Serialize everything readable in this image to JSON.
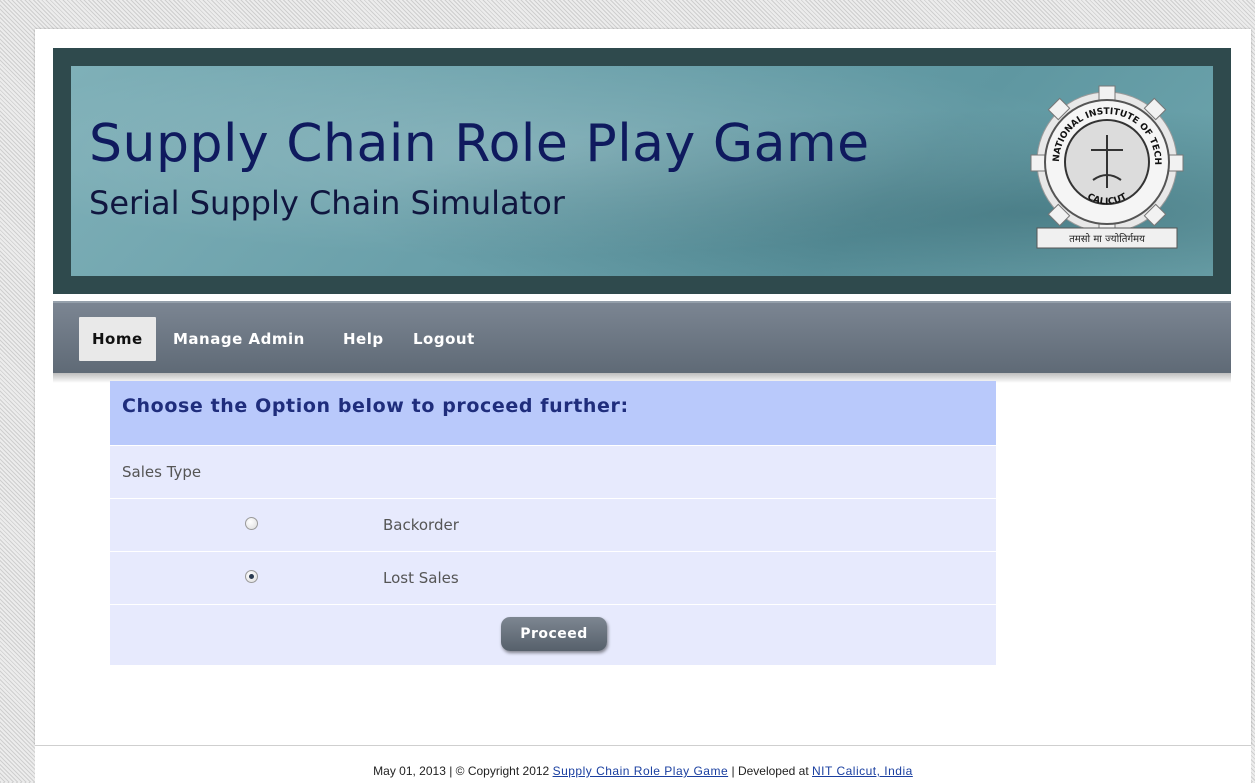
{
  "banner": {
    "title": "Supply Chain Role Play Game",
    "subtitle": "Serial Supply Chain Simulator",
    "logo_top_text": "NATIONAL INSTITUTE OF TECHNOLOGY",
    "logo_bottom_text": "CALICUT",
    "logo_motto": "तमसो मा ज्योतिर्गमय"
  },
  "nav": {
    "items": [
      {
        "label": "Home",
        "active": true
      },
      {
        "label": "Manage Admin",
        "active": false
      },
      {
        "label": "Help",
        "active": false
      },
      {
        "label": "Logout",
        "active": false
      }
    ]
  },
  "form": {
    "heading": "Choose the Option below to proceed further:",
    "section_label": "Sales Type",
    "options": [
      {
        "label": "Backorder",
        "checked": false
      },
      {
        "label": "Lost Sales",
        "checked": true
      }
    ],
    "submit_label": "Proceed"
  },
  "footer": {
    "date_copyright": "May 01, 2013 | © Copyright 2012 ",
    "game_link": "Supply Chain Role Play Game",
    "developed_at": " | Developed at ",
    "institute_link": "NIT Calicut, India"
  },
  "colors": {
    "banner_title": "#0f1a5e",
    "header_band": "#b9c9fb",
    "row_band": "#e7eafd",
    "link": "#1a3fa0"
  }
}
